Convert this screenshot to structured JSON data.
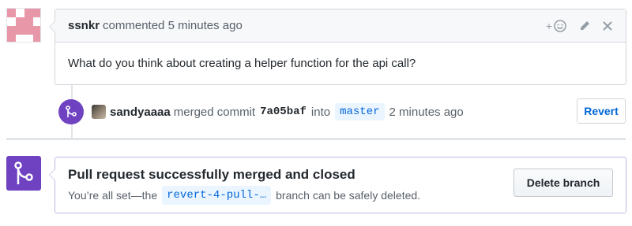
{
  "comment": {
    "author": "ssnkr",
    "action": "commented",
    "time": "5 minutes ago",
    "add_reaction_label": "+",
    "body": "What do you think about creating a helper function for the api call?",
    "icons": [
      "add-reaction-icon",
      "pencil-icon",
      "close-icon"
    ]
  },
  "merge_event": {
    "actor": "sandyaaaa",
    "action": "merged commit",
    "sha": "7a05baf",
    "into": "into",
    "branch": "master",
    "time": "2 minutes ago",
    "revert_label": "Revert"
  },
  "merge_status": {
    "title": "Pull request successfully merged and closed",
    "sub_prefix": "You’re all set—the",
    "branch": "revert-4-pull-…",
    "sub_suffix": "branch can be safely deleted.",
    "delete_label": "Delete branch"
  },
  "colors": {
    "merge_purple": "#6f42c1",
    "link_blue": "#0366d6",
    "avatar_pink": "#e897a9"
  }
}
